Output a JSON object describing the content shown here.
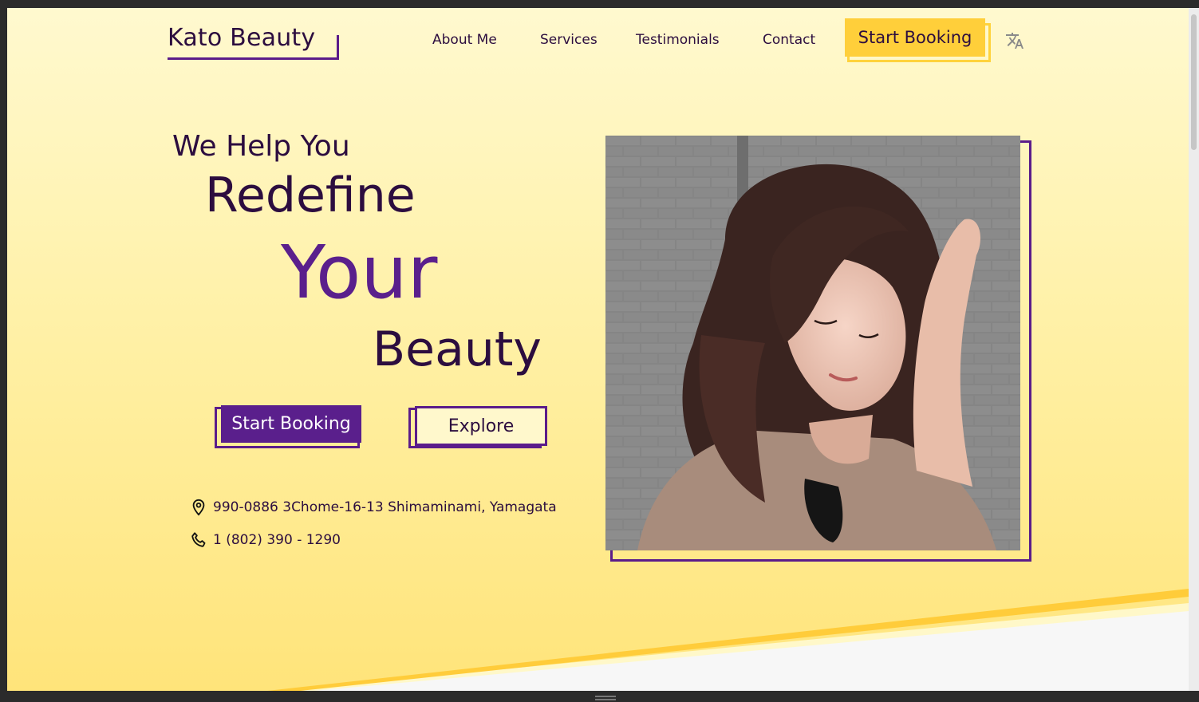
{
  "brand": {
    "name": "Kato Beauty"
  },
  "nav": {
    "links": [
      "About Me",
      "Services",
      "Testimonials",
      "Contact"
    ],
    "cta_label": "Start Booking",
    "language_icon": "translate-icon"
  },
  "hero": {
    "line1": "We Help You",
    "line2": "Redefine",
    "line3": "Your",
    "line4": "Beauty",
    "primary_button": "Start Booking",
    "secondary_button": "Explore"
  },
  "contact": {
    "address": "990-0886 3Chome-16-13 Shimaminami, Yamagata",
    "address_icon": "location-pin-icon",
    "phone": "1 (802) 390 - 1290",
    "phone_icon": "phone-icon"
  },
  "colors": {
    "accent_purple": "#5a1f8c",
    "accent_yellow": "#ffcf3a",
    "text_dark": "#2c0d3f"
  }
}
